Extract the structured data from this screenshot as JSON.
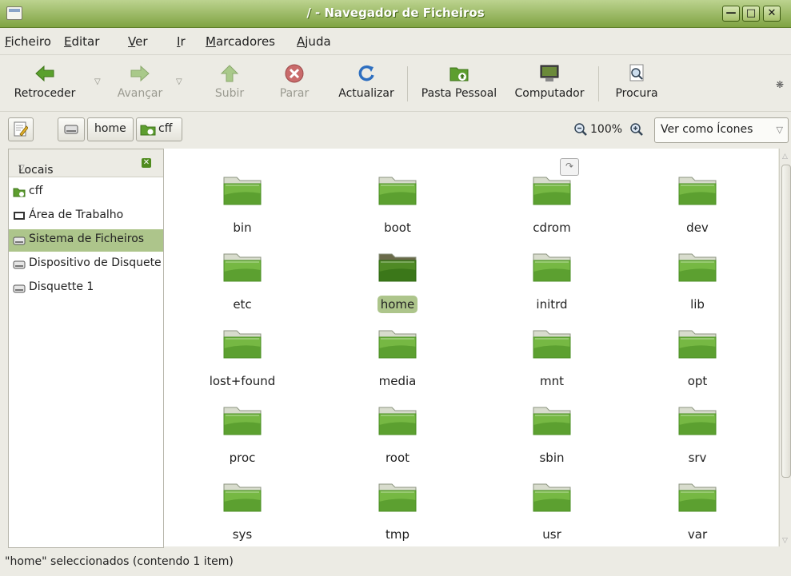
{
  "window": {
    "title": "/ - Navegador de Ficheiros"
  },
  "menu": [
    {
      "label": "Ficheiro",
      "mn": "F",
      "rest": "icheiro"
    },
    {
      "label": "Editar",
      "mn": "E",
      "rest": "ditar"
    },
    {
      "label": "Ver",
      "mn": "V",
      "rest": "er"
    },
    {
      "label": "Ir",
      "mn": "I",
      "rest": "r"
    },
    {
      "label": "Marcadores",
      "mn": "M",
      "rest": "arcadores"
    },
    {
      "label": "Ajuda",
      "mn": "A",
      "rest": "juda"
    }
  ],
  "toolbar": {
    "back": "Retroceder",
    "forward": "Avançar",
    "up": "Subir",
    "stop": "Parar",
    "reload": "Actualizar",
    "home": "Pasta Pessoal",
    "computer": "Computador",
    "search": "Procura"
  },
  "location": {
    "crumb_home": "home",
    "crumb_cff": "cff",
    "zoom": "100%",
    "view_mode": "Ver como Ícones"
  },
  "sidebar": {
    "header": "Locais",
    "items": [
      {
        "label": "cff",
        "icon": "home-folder-icon"
      },
      {
        "label": "Área de Trabalho",
        "icon": "desktop-icon"
      },
      {
        "label": "Sistema de Ficheiros",
        "icon": "drive-icon",
        "selected": true
      },
      {
        "label": "Dispositivo de Disquete",
        "icon": "drive-icon"
      },
      {
        "label": "Disquette 1",
        "icon": "drive-icon"
      }
    ]
  },
  "folders": [
    {
      "name": "bin"
    },
    {
      "name": "boot"
    },
    {
      "name": "cdrom"
    },
    {
      "name": "dev"
    },
    {
      "name": "etc"
    },
    {
      "name": "home",
      "selected": true
    },
    {
      "name": "initrd"
    },
    {
      "name": "lib"
    },
    {
      "name": "lost+found"
    },
    {
      "name": "media"
    },
    {
      "name": "mnt"
    },
    {
      "name": "opt"
    },
    {
      "name": "proc"
    },
    {
      "name": "root"
    },
    {
      "name": "sbin"
    },
    {
      "name": "srv"
    },
    {
      "name": "sys"
    },
    {
      "name": "tmp"
    },
    {
      "name": "usr"
    },
    {
      "name": "var"
    }
  ],
  "status": "\"home\" seleccionados (contendo 1 item)",
  "colors": {
    "folder": "#6fae3d",
    "folder_dark": "#3f7d1d",
    "selection": "#adc58b",
    "titlebar": "#8fb04f"
  }
}
